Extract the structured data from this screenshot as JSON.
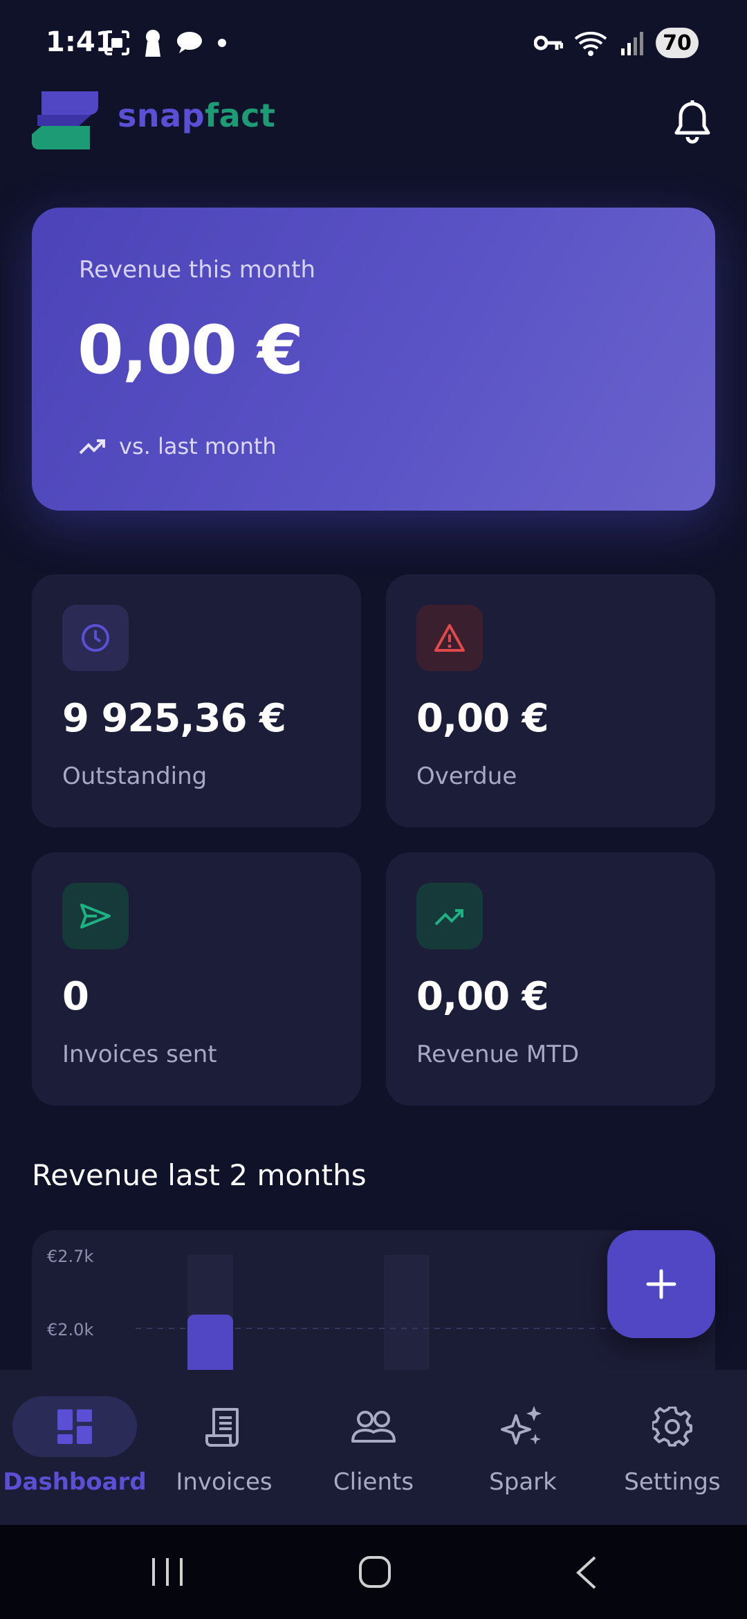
{
  "status_bar": {
    "time": "1:41",
    "battery": "70"
  },
  "header": {
    "brand_part1": "snap",
    "brand_part2": "fact"
  },
  "hero": {
    "label": "Revenue this month",
    "value": "0,00 €",
    "trend_text": "vs. last month"
  },
  "stats": [
    {
      "value": "9 925,36 €",
      "label": "Outstanding",
      "icon": "clock-icon"
    },
    {
      "value": "0,00 €",
      "label": "Overdue",
      "icon": "warning-icon"
    },
    {
      "value": "0",
      "label": "Invoices sent",
      "icon": "send-icon"
    },
    {
      "value": "0,00 €",
      "label": "Revenue MTD",
      "icon": "trending-up-icon"
    }
  ],
  "chart_section": {
    "title": "Revenue last 2 months"
  },
  "chart_data": {
    "type": "bar",
    "title": "Revenue last 2 months",
    "y_tick_labels": [
      "€2.7k",
      "€2.0k"
    ],
    "y_ticks": [
      2700,
      2000
    ],
    "ylim": [
      0,
      2700
    ],
    "series": [
      {
        "values": [
          2000,
          0
        ]
      }
    ],
    "categories": [
      "",
      ""
    ],
    "grid": true
  },
  "colors": {
    "accent": "#5147c4",
    "brand_green": "#1d9b75",
    "danger": "#e0484b"
  },
  "bottom_nav": {
    "items": [
      {
        "label": "Dashboard",
        "icon": "dashboard-icon",
        "active": true
      },
      {
        "label": "Invoices",
        "icon": "receipt-icon",
        "active": false
      },
      {
        "label": "Clients",
        "icon": "users-icon",
        "active": false
      },
      {
        "label": "Spark",
        "icon": "sparkles-icon",
        "active": false
      },
      {
        "label": "Settings",
        "icon": "gear-icon",
        "active": false
      }
    ]
  }
}
